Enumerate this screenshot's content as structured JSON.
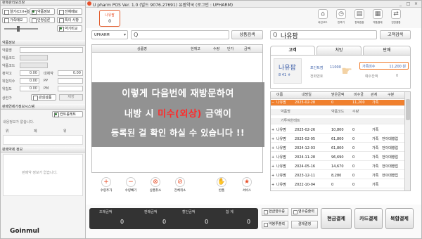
{
  "left_panel": {
    "section1_title": "판매관리보조창",
    "section1_buttons": [
      "알기(Ctrl+I)",
      "약품정보",
      "전체메모",
      "가족메모",
      "안정길론",
      "특이 사항",
      "약기비교"
    ],
    "section2_title": "약품정보",
    "drug_labels": [
      "약품명",
      "약품코드",
      "약품코드",
      "청약고",
      "위험지수",
      "위험도",
      "상한가"
    ],
    "drug_values": [
      "0.00",
      "0.00",
      "0.00",
      "0.00"
    ],
    "drug_labels_right": [
      "대체약",
      "PP",
      "PM"
    ],
    "drug_buttons": [
      "관심상품",
      "제장"
    ],
    "section3_title": "판매연제가정보시스템",
    "section3_checkbox": "컨트롤레트",
    "section3_text": "내용정보가 없습니다.",
    "section3_labels": [
      "위",
      "제",
      "위"
    ],
    "section4_title": "판매약제 정보",
    "section4_text": "판매약 정보가 없습니다."
  },
  "titlebar": {
    "title": "U pharm POS Ver. 1.0 (빌드 9076.27691) 유팜약국 (로그인 : UPHARM)",
    "controls": [
      "_",
      "□",
      "×"
    ]
  },
  "product_tab": {
    "label": "나유팜",
    "count": "0"
  },
  "toolbar": {
    "buttons": [
      "바인코드",
      "반측기",
      "판매집중",
      "약품결제",
      "전반결합"
    ]
  },
  "search": {
    "product_select": "UPHARM",
    "product_placeholder": "",
    "product_button": "상품검색",
    "customer_value": "나유팜",
    "customer_button": "고객검색"
  },
  "grid": {
    "headers": [
      "상품명",
      "현재고",
      "수량",
      "단가",
      "금액"
    ]
  },
  "overlay": {
    "line1": "이렇게 다음번에 재방문하여",
    "line2_pre": "내방 시 ",
    "line2_red": "미수(외상)",
    "line2_post": " 금액이",
    "line3": "등록된 걸 확인 하실 수 있습니다 !!"
  },
  "actions": [
    "수량추가",
    "수량빼기",
    "상품취소",
    "전체취소",
    "반품",
    "서비스"
  ],
  "right_tabs": [
    "고객",
    "처방",
    "판매"
  ],
  "customer": {
    "name": "나유팜",
    "age": "8 41 ㅎ",
    "point_label": "포인트점",
    "point_value": "11000",
    "visit_label": "전화번호",
    "visit_value": "",
    "balance_label": "가족미수",
    "balance_value": "11,200 원",
    "deposit_label": "예수잔액",
    "deposit_value": "0"
  },
  "history": {
    "headers": [
      "이름",
      "내방일",
      "받은금액",
      "미수금",
      "관계",
      "구분"
    ],
    "rows": [
      {
        "name": "나유팜",
        "date": "2025-02-28",
        "paid": "0",
        "due": "11,200",
        "rel": "가족",
        "kind": "",
        "selected": true
      },
      {
        "name": "약품명",
        "date": "",
        "paid": "약품코드",
        "due": "수량",
        "rel": "",
        "kind": "",
        "sub": true
      },
      {
        "name": "기투여한테트",
        "date": "",
        "paid": "",
        "due": "",
        "rel": "",
        "kind": "",
        "sub": true
      },
      {
        "name": "나유팜",
        "date": "2025-02-26",
        "paid": "10,800",
        "due": "0",
        "rel": "가족",
        "kind": ""
      },
      {
        "name": "나유팜",
        "date": "2025-02-05",
        "paid": "61,800",
        "due": "0",
        "rel": "가족",
        "kind": "전이대행업"
      },
      {
        "name": "나유팜",
        "date": "2024-12-03",
        "paid": "61,800",
        "due": "0",
        "rel": "가족",
        "kind": "전이대행업"
      },
      {
        "name": "나유팜",
        "date": "2024-11-28",
        "paid": "96,690",
        "due": "0",
        "rel": "가족",
        "kind": "전이대행업"
      },
      {
        "name": "나유팜",
        "date": "2024-05-16",
        "paid": "14,670",
        "due": "0",
        "rel": "가족",
        "kind": "전이대행업"
      },
      {
        "name": "나유팜",
        "date": "2023-12-11",
        "paid": "8,280",
        "due": "0",
        "rel": "가족",
        "kind": "전이대행업"
      },
      {
        "name": "나유팜",
        "date": "2022-10-04",
        "paid": "0",
        "due": "0",
        "rel": "가족",
        "kind": ""
      }
    ]
  },
  "footer": {
    "sum_labels": [
      "조제금액",
      "판매금액",
      "할인금액",
      "합 계"
    ],
    "sum_values": [
      "0",
      "0",
      "0",
      "0"
    ],
    "checks": [
      "현금영수증",
      "영수증출력",
      "약봉투출력"
    ],
    "settle_button": "결제결정",
    "pay_buttons": [
      "현금결제",
      "카드결제",
      "복합결제"
    ]
  },
  "watermark": "Goinmul",
  "colors": {
    "accent": "#e8502a",
    "selected_row": "#f0802e",
    "overlay": "#8a8a8a",
    "overlay_red": "#ff2a2a"
  }
}
